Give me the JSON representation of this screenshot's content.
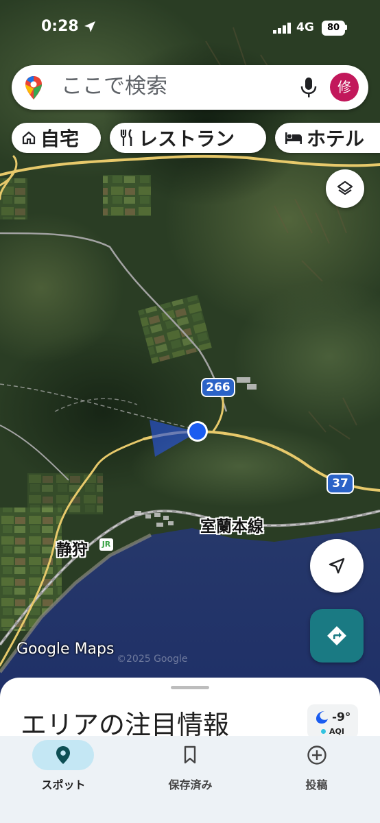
{
  "status_bar": {
    "time": "0:28",
    "network": "4G",
    "battery": "80"
  },
  "search": {
    "placeholder": "ここで検索",
    "avatar_initial": "修"
  },
  "chips": [
    {
      "label": "自宅",
      "icon": "home-icon"
    },
    {
      "label": "レストラン",
      "icon": "fork-knife-icon"
    },
    {
      "label": "ホテル",
      "icon": "bed-icon"
    }
  ],
  "map": {
    "labels": {
      "station": "静狩",
      "jr_badge": "JR",
      "railway": "室蘭本線"
    },
    "route_shields": [
      "266",
      "37"
    ],
    "logo": "Google Maps",
    "copyright": "©2025 Google"
  },
  "sheet": {
    "title": "エリアの注目情報",
    "weather": {
      "temperature": "-9°",
      "aqi_label": "AQI",
      "icon": "moon-icon"
    }
  },
  "bottom_nav": [
    {
      "label": "スポット",
      "icon": "map-pin-icon",
      "active": true
    },
    {
      "label": "保存済み",
      "icon": "bookmark-icon",
      "active": false
    },
    {
      "label": "投稿",
      "icon": "plus-circle-icon",
      "active": false
    }
  ],
  "colors": {
    "accent": "#1a7a83",
    "active_nav_pill": "#c4e7f4",
    "location_dot": "#1a5cf0",
    "road": "#e7c96b",
    "water": "#1d2f6b"
  }
}
